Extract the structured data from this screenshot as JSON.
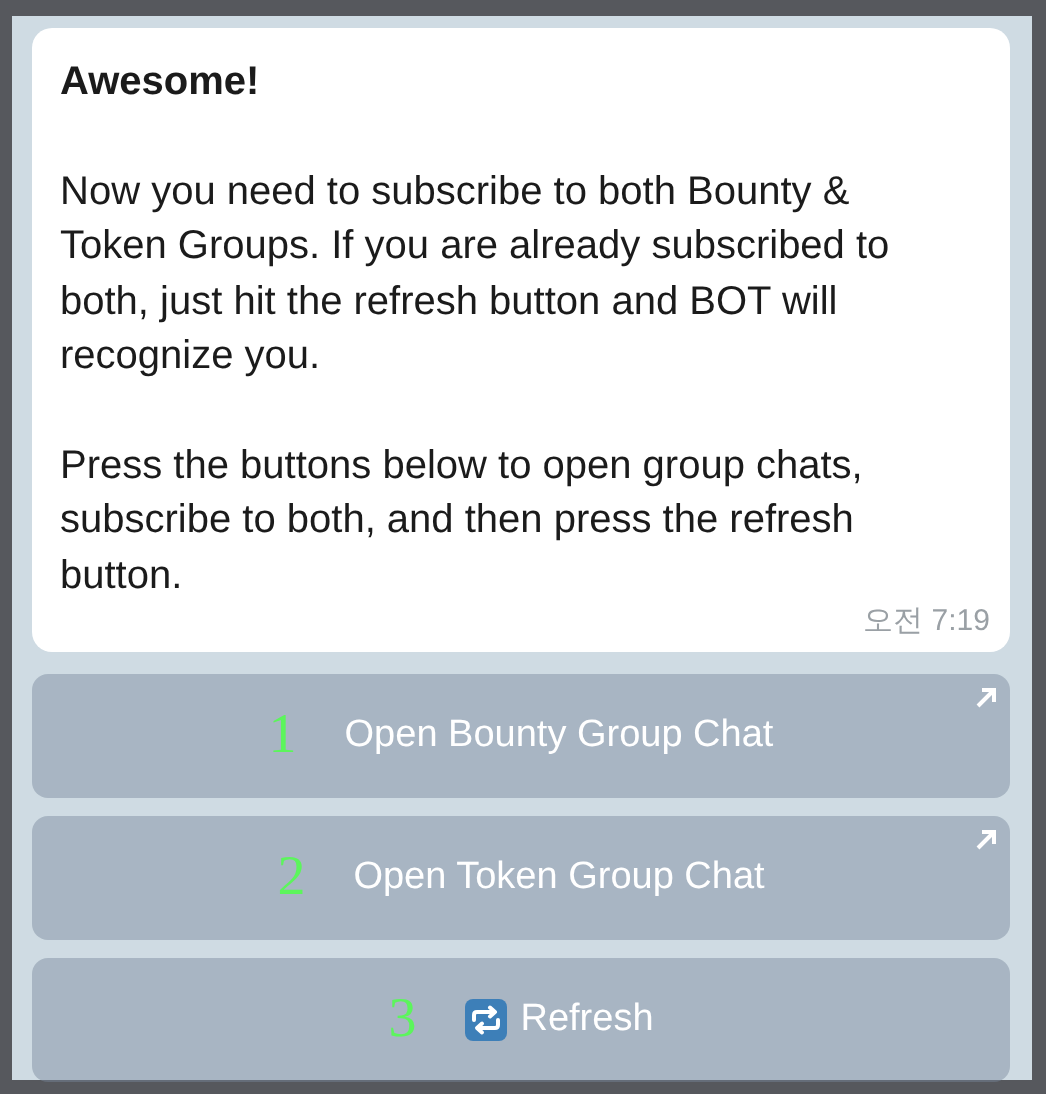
{
  "message": {
    "title": "Awesome!",
    "paragraphs": [
      "Now you need to subscribe to both Bounty & Token Groups. If you are already subscribed to both, just hit the refresh button and BOT will recognize you.",
      "Press the buttons below to open group chats, subscribe to both, and then press the refresh button."
    ],
    "time": "오전 7:19"
  },
  "buttons": [
    {
      "label": "Open Bounty Group Chat",
      "kind": "url",
      "annotation": "1"
    },
    {
      "label": "Open Token Group Chat",
      "kind": "url",
      "annotation": "2"
    },
    {
      "label": "Refresh",
      "kind": "refresh",
      "annotation": "3"
    }
  ]
}
